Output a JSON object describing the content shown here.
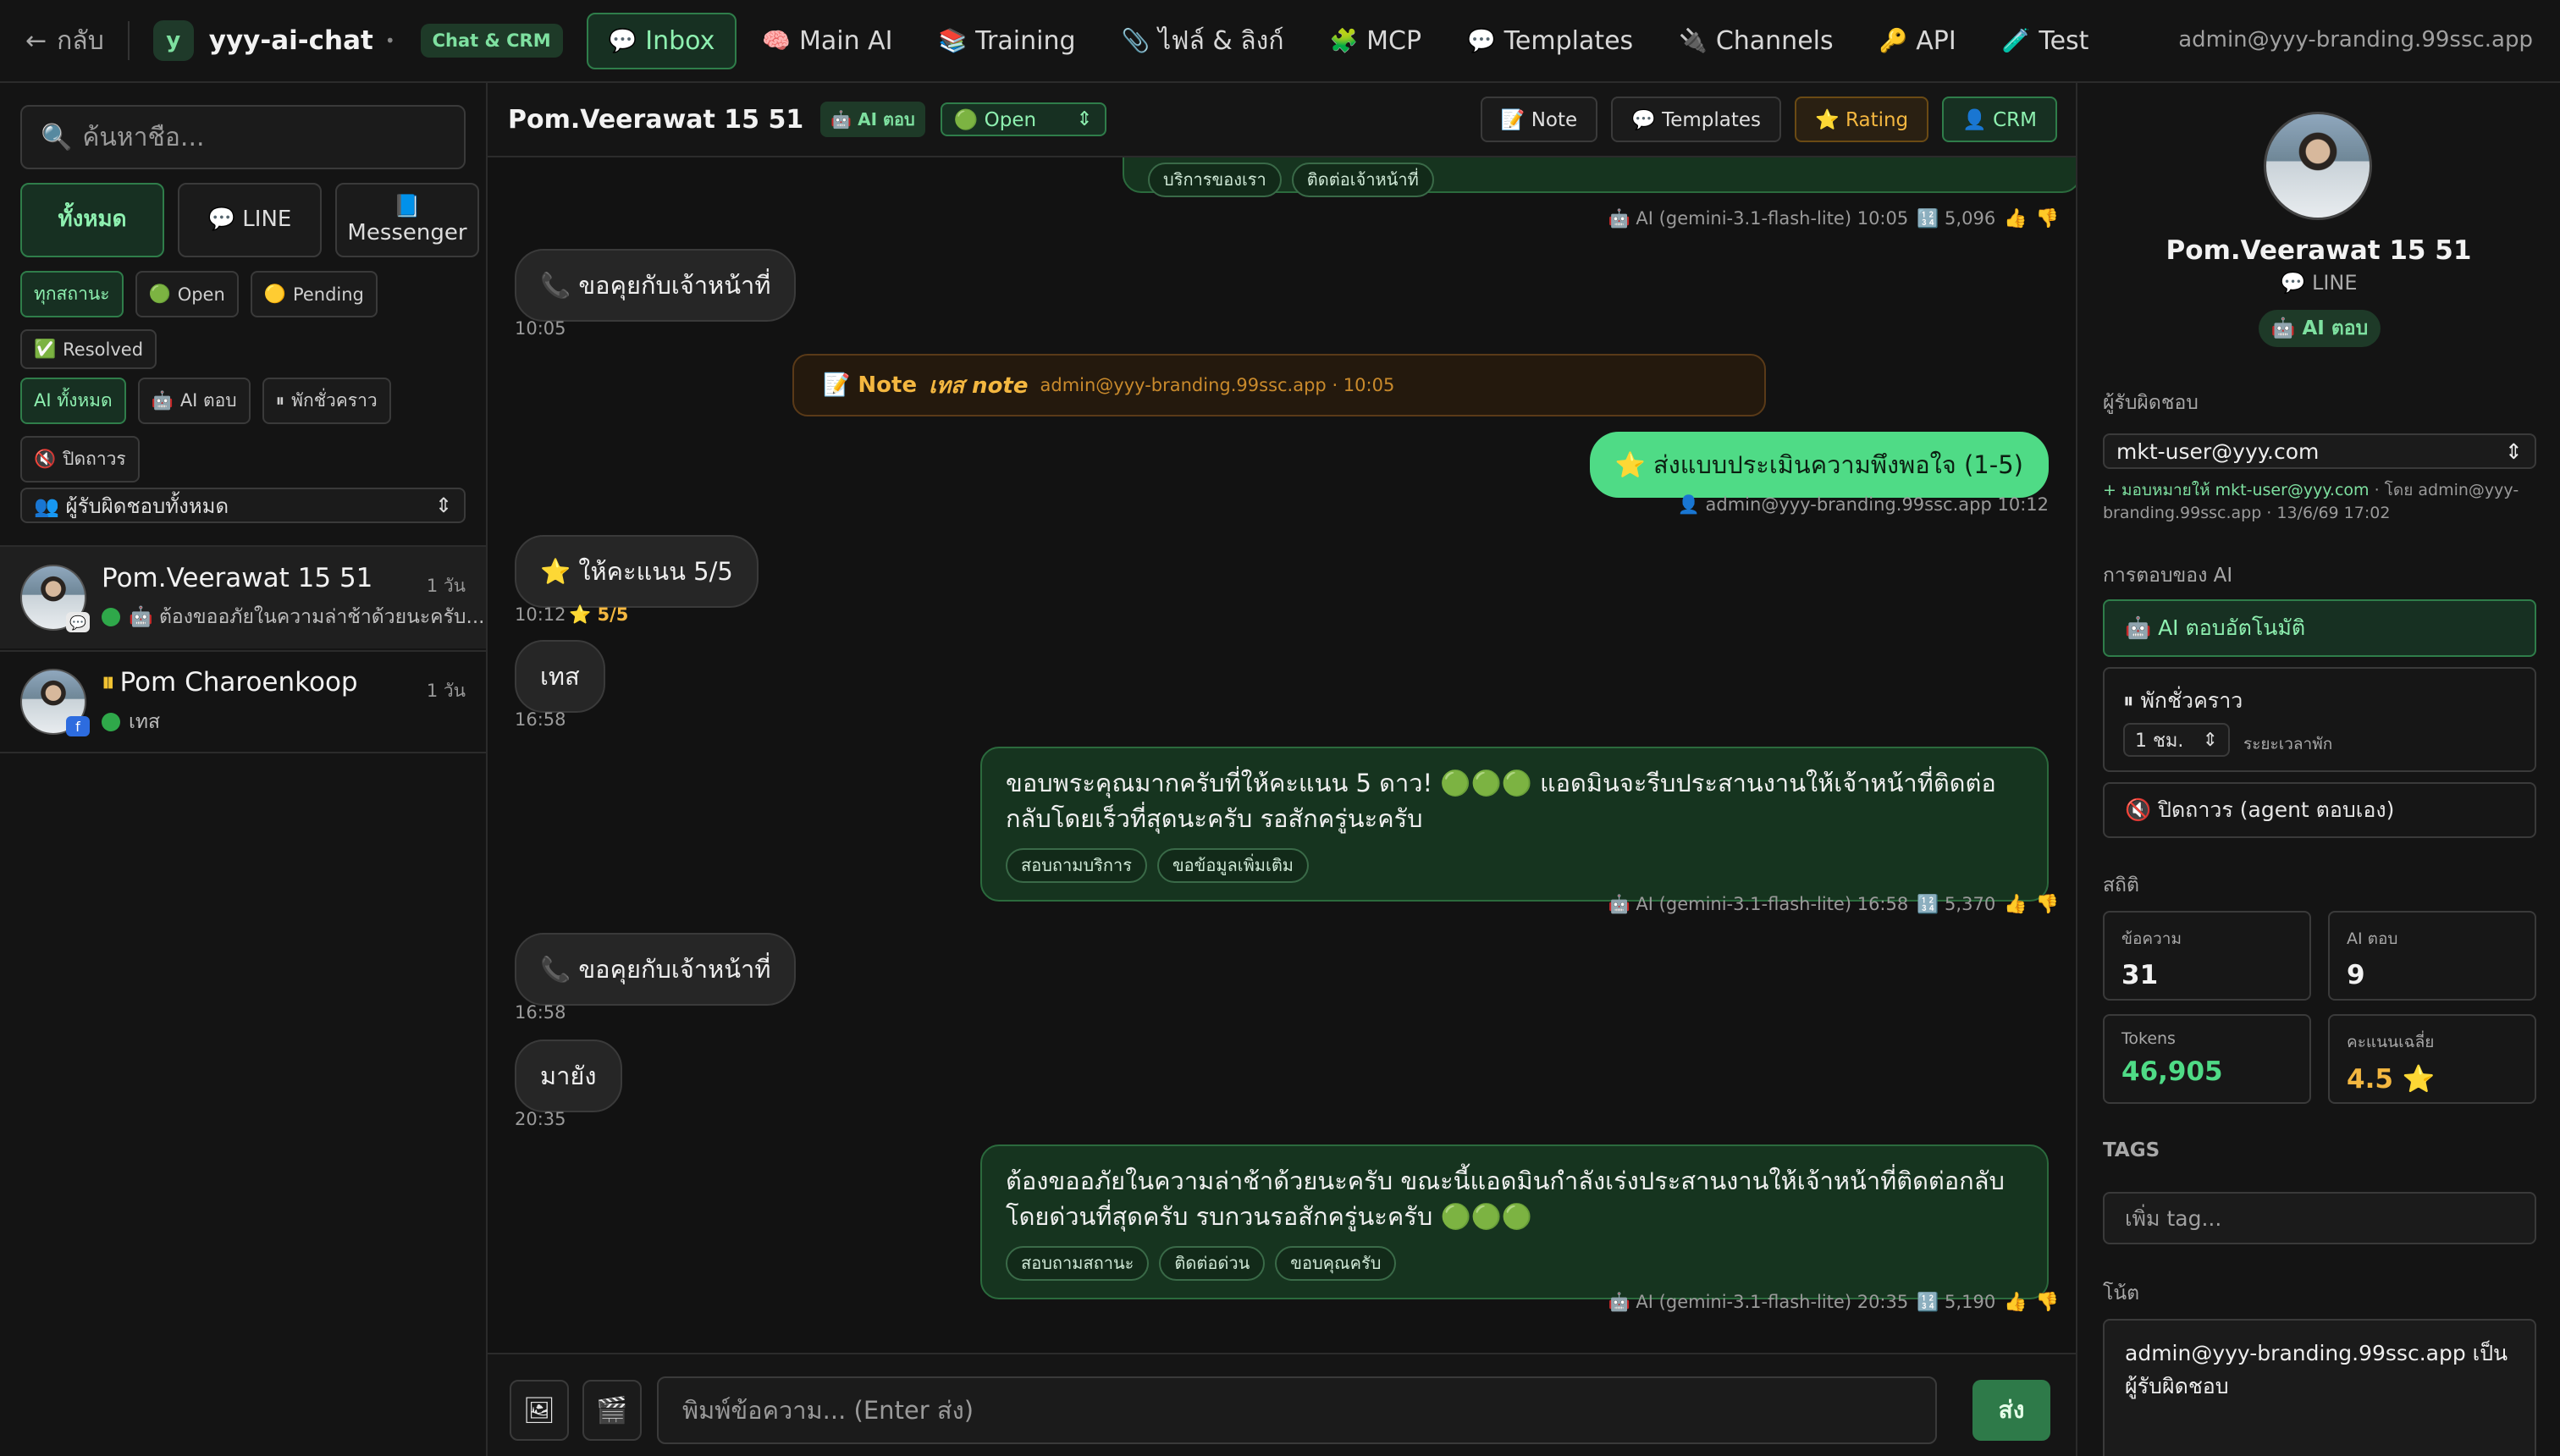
{
  "topnav": {
    "back_label": "กลับ",
    "logo_letter": "y",
    "app_name": "yyy-ai-chat",
    "app_tag": "Chat & CRM",
    "tabs": [
      {
        "icon": "💬",
        "label": "Inbox"
      },
      {
        "icon": "🧠",
        "label": "Main AI"
      },
      {
        "icon": "📚",
        "label": "Training"
      },
      {
        "icon": "📎",
        "label": "ไฟล์ & ลิงก์"
      },
      {
        "icon": "🧩",
        "label": "MCP"
      },
      {
        "icon": "💬",
        "label": "Templates"
      },
      {
        "icon": "🔌",
        "label": "Channels"
      },
      {
        "icon": "🔑",
        "label": "API"
      },
      {
        "icon": "🧪",
        "label": "Test"
      }
    ],
    "active_tab": "Inbox",
    "user": "admin@yyy-branding.99ssc.app"
  },
  "sidebar": {
    "search_placeholder": "ค้นหาชื่อ...",
    "channels": [
      {
        "label": "ทั้งหมด",
        "icon": ""
      },
      {
        "label": "LINE",
        "icon": "💬"
      },
      {
        "label": "Messenger",
        "icon": "📘"
      }
    ],
    "status_filters": [
      {
        "label": "ทุกสถานะ",
        "icon": ""
      },
      {
        "label": "Open",
        "icon": "🟢"
      },
      {
        "label": "Pending",
        "icon": "🟡"
      },
      {
        "label": "Resolved",
        "icon": "✅"
      }
    ],
    "ai_filters": [
      {
        "label": "AI ทั้งหมด",
        "icon": ""
      },
      {
        "label": "AI ตอบ",
        "icon": "🤖"
      },
      {
        "label": "พักชั่วคราว",
        "icon": "⏸"
      },
      {
        "label": "ปิดถาวร",
        "icon": "🔇"
      }
    ],
    "owner_filter": "👥 ผู้รับผิดชอบทั้งหมด",
    "conversations": [
      {
        "name": "Pom.Veerawat 15 51",
        "time": "1 วัน",
        "preview": "🤖 ต้องขออภัยในความล่าช้าด้วยนะครับ..."
      },
      {
        "name": "Pom Charoenkoop",
        "time": "1 วัน",
        "preview": "เทส"
      }
    ]
  },
  "chat": {
    "header": {
      "name": "Pom.Veerawat 15 51",
      "ai_badge": "🤖 AI ตอบ",
      "status": "🟢 Open",
      "buttons": {
        "note": "📝 Note",
        "templates": "💬 Templates",
        "rating": "⭐ Rating",
        "crm": "👤 CRM"
      }
    },
    "top_replies": [
      "บริการของเรา",
      "ติดต่อเจ้าหน้าที่"
    ],
    "top_meta": {
      "model": "🤖 AI (gemini-3.1-flash-lite) 10:05",
      "tokens": "🔢 5,096"
    },
    "msg1": {
      "text": "📞 ขอคุยกับเจ้าหน้าที่",
      "time": "10:05"
    },
    "note": {
      "label": "📝 Note",
      "text": "เทส note",
      "meta": "admin@yyy-branding.99ssc.app · 10:05"
    },
    "agent_msg": {
      "text": "⭐ ส่งแบบประเมินความพึงพอใจ (1-5)",
      "meta": "👤 admin@yyy-branding.99ssc.app 10:12"
    },
    "rating_msg": {
      "text": "⭐ ให้คะแนน 5/5",
      "time": "10:12",
      "stars": "⭐ 5/5"
    },
    "msg_test": {
      "text": "เทส",
      "time": "16:58"
    },
    "ai_reply1": {
      "text": "ขอบพระคุณมากครับที่ให้คะแนน 5 ดาว! 🟢🟢🟢 แอดมินจะรีบประสานงานให้เจ้าหน้าที่ติดต่อกลับโดยเร็วที่สุดนะครับ รอสักครู่นะครับ",
      "replies": [
        "สอบถามบริการ",
        "ขอข้อมูลเพิ่มเติม"
      ],
      "model": "🤖 AI (gemini-3.1-flash-lite) 16:58",
      "tokens": "🔢 5,370"
    },
    "msg2": {
      "text": "📞 ขอคุยกับเจ้าหน้าที่",
      "time": "16:58"
    },
    "msg3": {
      "text": "มายัง",
      "time": "20:35"
    },
    "ai_reply2": {
      "text": "ต้องขออภัยในความล่าช้าด้วยนะครับ ขณะนี้แอดมินกำลังเร่งประสานงานให้เจ้าหน้าที่ติดต่อกลับโดยด่วนที่สุดครับ รบกวนรอสักครู่นะครับ 🟢🟢🟢",
      "replies": [
        "สอบถามสถานะ",
        "ติดต่อด่วน",
        "ขอบคุณครับ"
      ],
      "model": "🤖 AI (gemini-3.1-flash-lite) 20:35",
      "tokens": "🔢 5,190"
    },
    "composer": {
      "placeholder": "พิมพ์ข้อความ... (Enter ส่ง)",
      "send": "ส่ง",
      "image_icon": "🖼",
      "video_icon": "🎬"
    }
  },
  "profile": {
    "name": "Pom.Veerawat 15 51",
    "channel": "💬 LINE",
    "ai_badge": "🤖 AI ตอบ",
    "owner_label": "ผู้รับผิดชอบ",
    "owner": "mkt-user@yyy.com",
    "assign_action": "+ มอบหมายให้ mkt-user@yyy.com",
    "assign_meta": " · โดย admin@yyy-branding.99ssc.app · 13/6/69 17:02",
    "ai_section": "การตอบของ AI",
    "ai_auto": "🤖 AI ตอบอัตโนมัติ",
    "pause_title": "⏸ พักชั่วคราว",
    "pause_value": "1 ชม.",
    "pause_label": "ระยะเวลาพัก",
    "off_label": "🔇 ปิดถาวร (agent ตอบเอง)",
    "stats_label": "สถิติ",
    "stats": [
      {
        "label": "ข้อความ",
        "value": "31"
      },
      {
        "label": "AI ตอบ",
        "value": "9"
      },
      {
        "label": "Tokens",
        "value": "46,905"
      },
      {
        "label": "คะแนนเฉลี่ย",
        "value": "4.5 ⭐"
      }
    ],
    "tags_label": "TAGS",
    "tag_placeholder": "เพิ่ม tag...",
    "note_label": "โน้ต",
    "note_text": "admin@yyy-branding.99ssc.app เป็นผู้รับผิดชอบ"
  }
}
